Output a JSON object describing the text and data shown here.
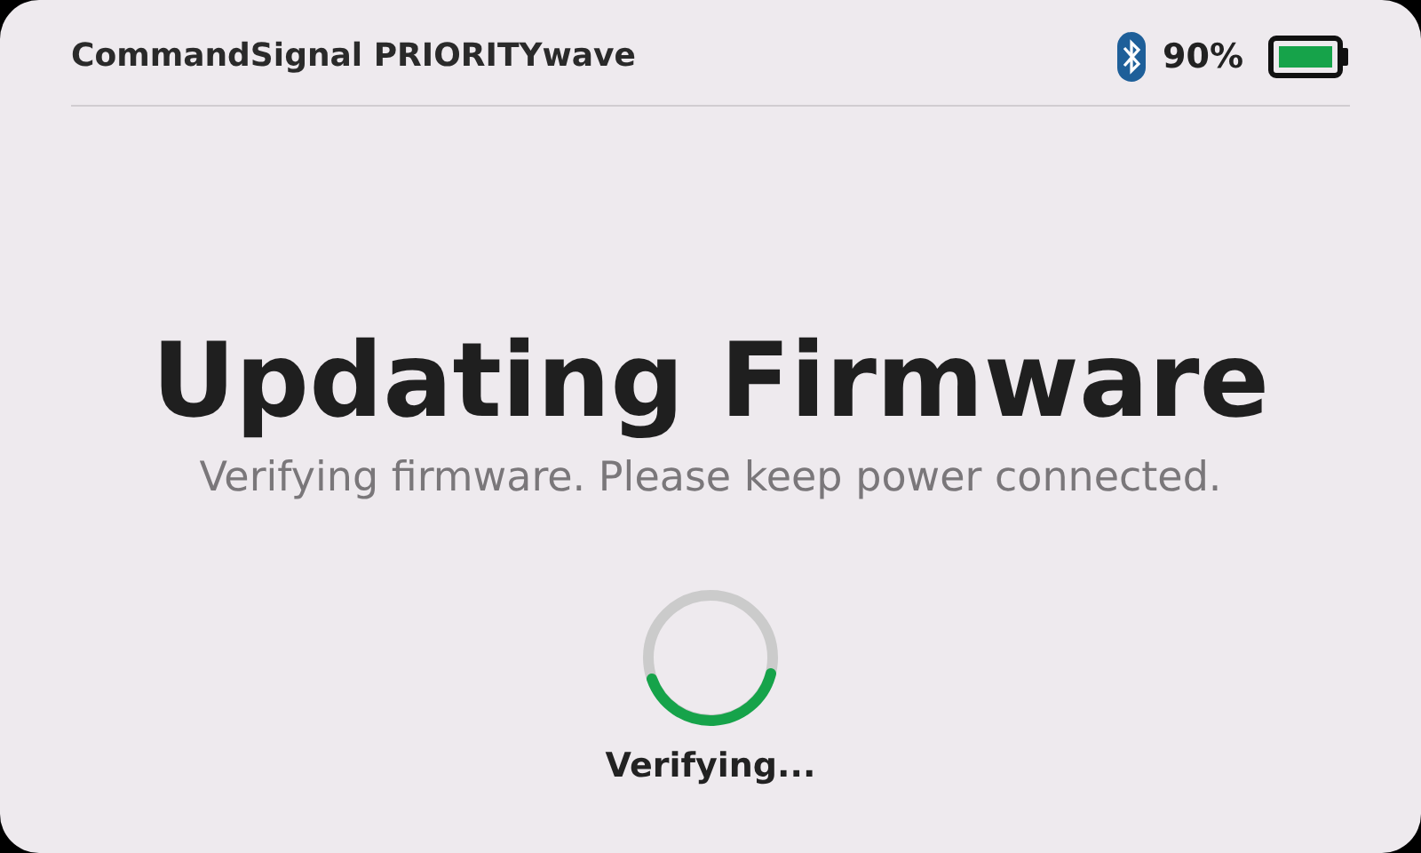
{
  "header": {
    "title": "CommandSignal PRIORITYwave",
    "battery_percent": "90%"
  },
  "heading": "Updating Firmware",
  "message": "Verifying firmware. Please keep power connected.",
  "status": "Verifying..."
}
